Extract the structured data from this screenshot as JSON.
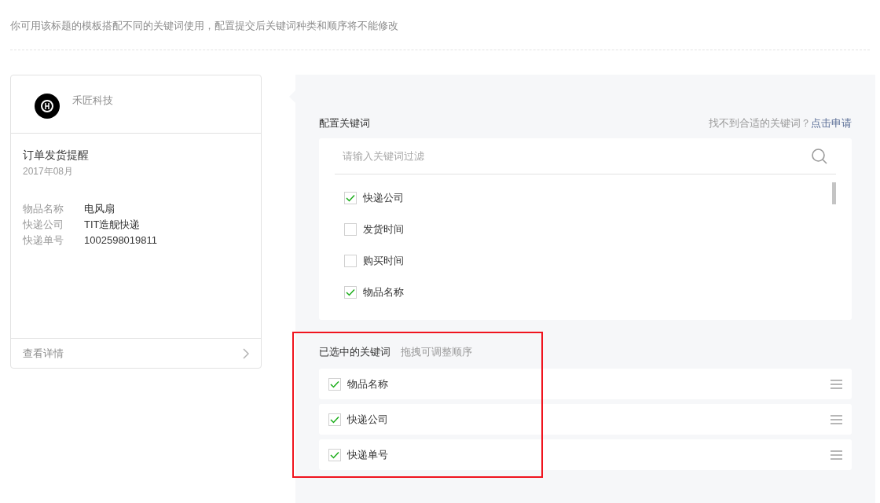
{
  "notice": "你可用该标题的模板搭配不同的关键词使用，配置提交后关键词种类和顺序将不能修改",
  "preview": {
    "account": "禾匠科技",
    "title": "订单发货提醒",
    "date": "2017年08月",
    "fields": [
      {
        "label": "物品名称",
        "value": "电风扇"
      },
      {
        "label": "快递公司",
        "value": "TIT造舰快递"
      },
      {
        "label": "快递单号",
        "value": "1002598019811"
      }
    ],
    "detail_link": "查看详情"
  },
  "config": {
    "title": "配置关键词",
    "hint": "找不到合适的关键词？",
    "apply_link": "点击申请",
    "search": {
      "placeholder": "请输入关键词过滤"
    },
    "keywords": [
      {
        "label": "快递公司",
        "checked": true
      },
      {
        "label": "发货时间",
        "checked": false
      },
      {
        "label": "购买时间",
        "checked": false
      },
      {
        "label": "物品名称",
        "checked": true
      }
    ]
  },
  "selected": {
    "title": "已选中的关键词",
    "hint": "拖拽可调整顺序",
    "items": [
      {
        "label": "物品名称",
        "checked": true
      },
      {
        "label": "快递公司",
        "checked": true
      },
      {
        "label": "快递单号",
        "checked": true
      }
    ]
  }
}
